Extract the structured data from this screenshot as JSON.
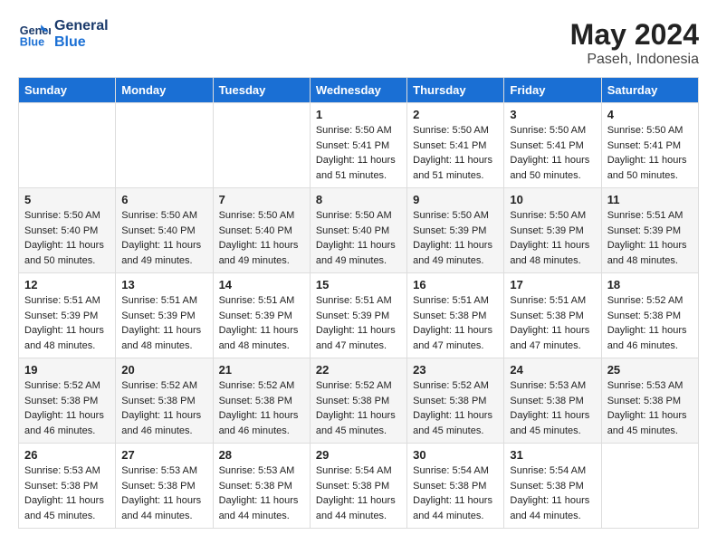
{
  "logo": {
    "line1": "General",
    "line2": "Blue"
  },
  "title": "May 2024",
  "location": "Paseh, Indonesia",
  "days_of_week": [
    "Sunday",
    "Monday",
    "Tuesday",
    "Wednesday",
    "Thursday",
    "Friday",
    "Saturday"
  ],
  "weeks": [
    [
      {
        "day": "",
        "info": ""
      },
      {
        "day": "",
        "info": ""
      },
      {
        "day": "",
        "info": ""
      },
      {
        "day": "1",
        "info": "Sunrise: 5:50 AM\nSunset: 5:41 PM\nDaylight: 11 hours\nand 51 minutes."
      },
      {
        "day": "2",
        "info": "Sunrise: 5:50 AM\nSunset: 5:41 PM\nDaylight: 11 hours\nand 51 minutes."
      },
      {
        "day": "3",
        "info": "Sunrise: 5:50 AM\nSunset: 5:41 PM\nDaylight: 11 hours\nand 50 minutes."
      },
      {
        "day": "4",
        "info": "Sunrise: 5:50 AM\nSunset: 5:41 PM\nDaylight: 11 hours\nand 50 minutes."
      }
    ],
    [
      {
        "day": "5",
        "info": "Sunrise: 5:50 AM\nSunset: 5:40 PM\nDaylight: 11 hours\nand 50 minutes."
      },
      {
        "day": "6",
        "info": "Sunrise: 5:50 AM\nSunset: 5:40 PM\nDaylight: 11 hours\nand 49 minutes."
      },
      {
        "day": "7",
        "info": "Sunrise: 5:50 AM\nSunset: 5:40 PM\nDaylight: 11 hours\nand 49 minutes."
      },
      {
        "day": "8",
        "info": "Sunrise: 5:50 AM\nSunset: 5:40 PM\nDaylight: 11 hours\nand 49 minutes."
      },
      {
        "day": "9",
        "info": "Sunrise: 5:50 AM\nSunset: 5:39 PM\nDaylight: 11 hours\nand 49 minutes."
      },
      {
        "day": "10",
        "info": "Sunrise: 5:50 AM\nSunset: 5:39 PM\nDaylight: 11 hours\nand 48 minutes."
      },
      {
        "day": "11",
        "info": "Sunrise: 5:51 AM\nSunset: 5:39 PM\nDaylight: 11 hours\nand 48 minutes."
      }
    ],
    [
      {
        "day": "12",
        "info": "Sunrise: 5:51 AM\nSunset: 5:39 PM\nDaylight: 11 hours\nand 48 minutes."
      },
      {
        "day": "13",
        "info": "Sunrise: 5:51 AM\nSunset: 5:39 PM\nDaylight: 11 hours\nand 48 minutes."
      },
      {
        "day": "14",
        "info": "Sunrise: 5:51 AM\nSunset: 5:39 PM\nDaylight: 11 hours\nand 48 minutes."
      },
      {
        "day": "15",
        "info": "Sunrise: 5:51 AM\nSunset: 5:39 PM\nDaylight: 11 hours\nand 47 minutes."
      },
      {
        "day": "16",
        "info": "Sunrise: 5:51 AM\nSunset: 5:38 PM\nDaylight: 11 hours\nand 47 minutes."
      },
      {
        "day": "17",
        "info": "Sunrise: 5:51 AM\nSunset: 5:38 PM\nDaylight: 11 hours\nand 47 minutes."
      },
      {
        "day": "18",
        "info": "Sunrise: 5:52 AM\nSunset: 5:38 PM\nDaylight: 11 hours\nand 46 minutes."
      }
    ],
    [
      {
        "day": "19",
        "info": "Sunrise: 5:52 AM\nSunset: 5:38 PM\nDaylight: 11 hours\nand 46 minutes."
      },
      {
        "day": "20",
        "info": "Sunrise: 5:52 AM\nSunset: 5:38 PM\nDaylight: 11 hours\nand 46 minutes."
      },
      {
        "day": "21",
        "info": "Sunrise: 5:52 AM\nSunset: 5:38 PM\nDaylight: 11 hours\nand 46 minutes."
      },
      {
        "day": "22",
        "info": "Sunrise: 5:52 AM\nSunset: 5:38 PM\nDaylight: 11 hours\nand 45 minutes."
      },
      {
        "day": "23",
        "info": "Sunrise: 5:52 AM\nSunset: 5:38 PM\nDaylight: 11 hours\nand 45 minutes."
      },
      {
        "day": "24",
        "info": "Sunrise: 5:53 AM\nSunset: 5:38 PM\nDaylight: 11 hours\nand 45 minutes."
      },
      {
        "day": "25",
        "info": "Sunrise: 5:53 AM\nSunset: 5:38 PM\nDaylight: 11 hours\nand 45 minutes."
      }
    ],
    [
      {
        "day": "26",
        "info": "Sunrise: 5:53 AM\nSunset: 5:38 PM\nDaylight: 11 hours\nand 45 minutes."
      },
      {
        "day": "27",
        "info": "Sunrise: 5:53 AM\nSunset: 5:38 PM\nDaylight: 11 hours\nand 44 minutes."
      },
      {
        "day": "28",
        "info": "Sunrise: 5:53 AM\nSunset: 5:38 PM\nDaylight: 11 hours\nand 44 minutes."
      },
      {
        "day": "29",
        "info": "Sunrise: 5:54 AM\nSunset: 5:38 PM\nDaylight: 11 hours\nand 44 minutes."
      },
      {
        "day": "30",
        "info": "Sunrise: 5:54 AM\nSunset: 5:38 PM\nDaylight: 11 hours\nand 44 minutes."
      },
      {
        "day": "31",
        "info": "Sunrise: 5:54 AM\nSunset: 5:38 PM\nDaylight: 11 hours\nand 44 minutes."
      },
      {
        "day": "",
        "info": ""
      }
    ]
  ]
}
